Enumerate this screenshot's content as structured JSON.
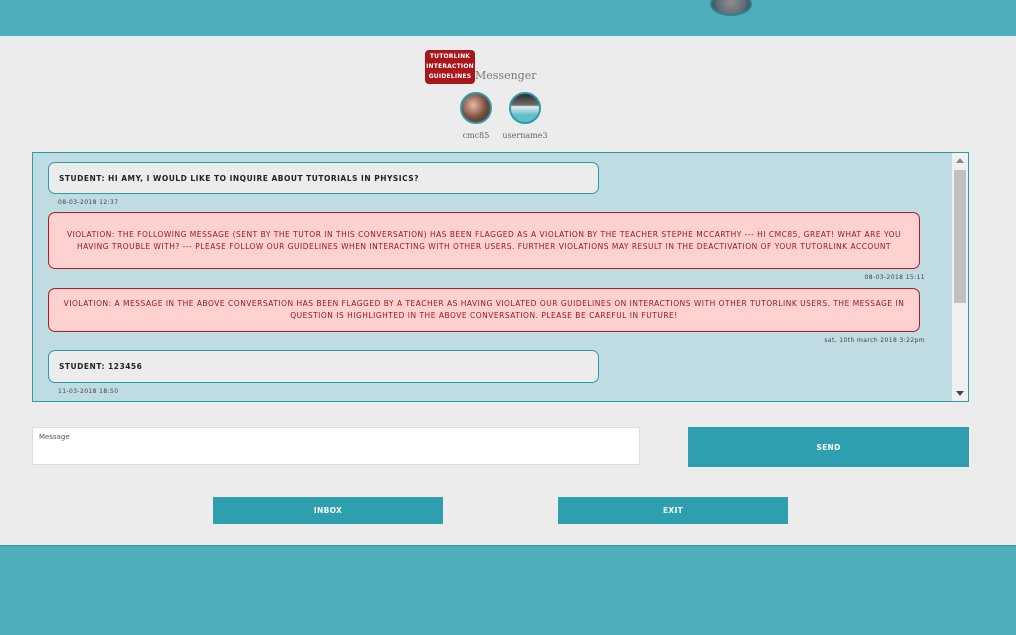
{
  "header": {
    "logo_lines": [
      "TUTORLINK",
      "INTERACTION",
      "GUIDELINES"
    ],
    "title": "Messenger"
  },
  "participants": [
    {
      "username": "cmc85"
    },
    {
      "username": "username3"
    }
  ],
  "messages": [
    {
      "type": "student",
      "text": "Student: hi Amy, I would like to inquire about tutorials in physics?",
      "timestamp": "08-03-2018 12:37"
    },
    {
      "type": "violation",
      "text": "Violation: The following message (sent by the tutor in this conversation) has been flagged as a violation by the teacher Stephe McCarthy --- hi cmc85, great! what are you having trouble with? --- Please follow our guidelines when interacting with other users. Further violations may result in the deactivation of your Tutorlink account",
      "timestamp": "08-03-2018 15:11"
    },
    {
      "type": "violation",
      "text": "Violation: A message in the above conversation has been flagged by a teacher as having violated our guidelines on interactions with other Tutorlink users. The message in question is highlighted in the above conversation. Please be careful in future!",
      "timestamp": "sat, 10th march 2018 3:22pm"
    },
    {
      "type": "student",
      "text": "Student: 123456",
      "timestamp": "11-03-2018 18:50"
    }
  ],
  "compose": {
    "placeholder": "Message",
    "send_label": "SEND"
  },
  "nav": {
    "inbox_label": "INBOX",
    "exit_label": "EXIT"
  },
  "colors": {
    "accent": "#2d9fae",
    "bar": "#4eaebc",
    "violation_bg": "#ffd1d1",
    "violation_text": "#9a1616"
  }
}
